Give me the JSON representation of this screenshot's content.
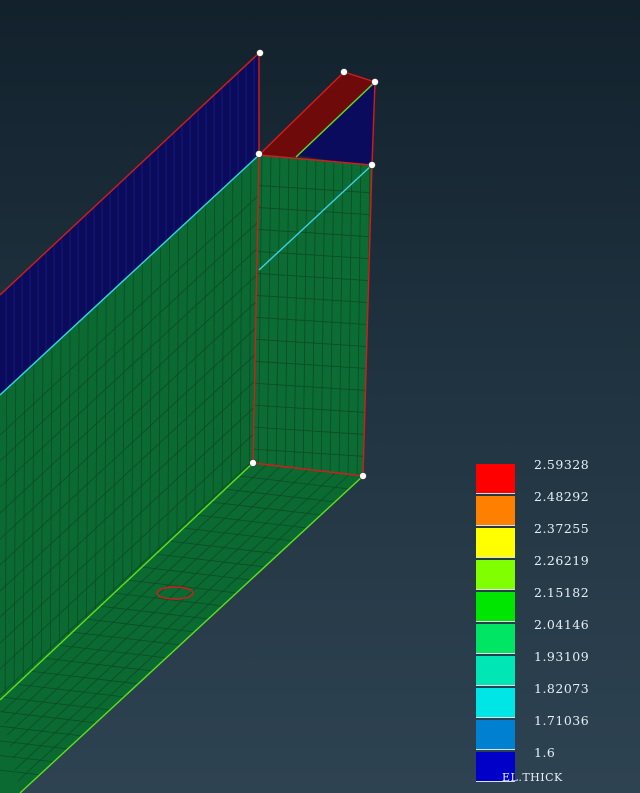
{
  "viewport": {
    "scene": "fe-thickness-contour",
    "colors": {
      "flange_blue": "#0a0b5c",
      "web_green": "#0a6a32",
      "flange_red": "#6e0a0a",
      "edge_red": "#d81a1a",
      "edge_cyan": "#38d2e6",
      "edge_green": "#5ee01c",
      "node_white": "#ffffff"
    }
  },
  "legend": {
    "title": "EL.THICK",
    "ticks": [
      "2.59328",
      "2.48292",
      "2.37255",
      "2.26219",
      "2.15182",
      "2.04146",
      "1.93109",
      "1.82073",
      "1.71036",
      "1.6"
    ],
    "colors": [
      "#ff0000",
      "#ff8000",
      "#ffff00",
      "#80ff00",
      "#00e600",
      "#00e664",
      "#00e6b4",
      "#00e6e6",
      "#0080d0",
      "#0000c8"
    ]
  }
}
